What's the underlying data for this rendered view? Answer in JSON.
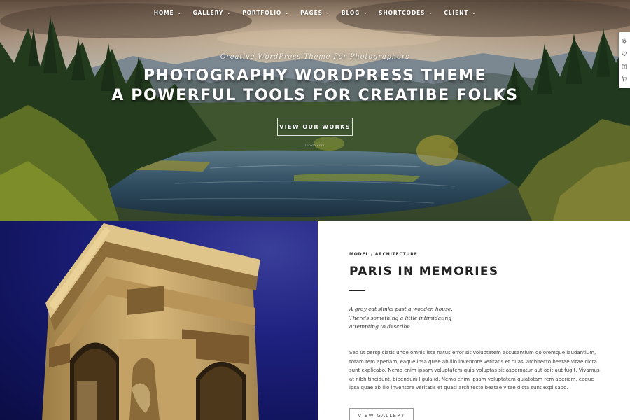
{
  "nav": {
    "items": [
      {
        "label": "HOME",
        "chevron": "chevron-down-icon"
      },
      {
        "label": "GALLERY",
        "chevron": "chevron-down-icon"
      },
      {
        "label": "PORTFOLIO",
        "chevron": "chevron-down-icon"
      },
      {
        "label": "PAGES",
        "chevron": "chevron-down-icon"
      },
      {
        "label": "BLOG",
        "chevron": "chevron-down-icon"
      },
      {
        "label": "SHORTCODES",
        "chevron": "chevron-down-icon"
      },
      {
        "label": "CLIENT",
        "chevron": "chevron-down-icon"
      }
    ]
  },
  "hero": {
    "subtitle": "Creative WordPress Theme For Photographers",
    "title_line1": "PHOTOGRAPHY WORDPRESS THEME",
    "title_line2": "A POWERFUL TOOLS FOR CREATIBE FOLKS",
    "button_label": "VIEW OUR WORKS",
    "caption": "lorem.com"
  },
  "tool_panel": {
    "icons": [
      "gear-icon",
      "heart-icon",
      "book-icon",
      "cart-icon"
    ]
  },
  "feature": {
    "category": "MODEL / ARCHITECTURE",
    "title": "PARIS IN MEMORIES",
    "quote_lines": [
      "A gray cat slinks past a wooden house.",
      "There's something a little intimidating",
      "attempting to describe"
    ],
    "body": "Sed ut perspiciatis unde omnis iste natus error sit voluptatem accusantium doloremque laudantium, totam rem aperiam, eaque ipsa quae ab illo inventore veritatis et quasi architecto beatae vitae dicta sunt explicabo. Nemo enim ipsam voluptatem quia voluptas sit aspernatur aut odit aut fugit. Vivamus at nibh tincidunt, bibendum ligula id. Nemo enim ipsam voluptatem quiatotam rem aperiam, eaque ipsa quae ab illo inventore veritatis et quasi architecto beatae vitae dicta sunt explicabo.",
    "button_label": "VIEW GALLERY"
  },
  "colors": {
    "text_dark": "#222222",
    "night_sky": "#1f2280",
    "stone": "#c9a86a",
    "lake": "#2c4d63"
  }
}
